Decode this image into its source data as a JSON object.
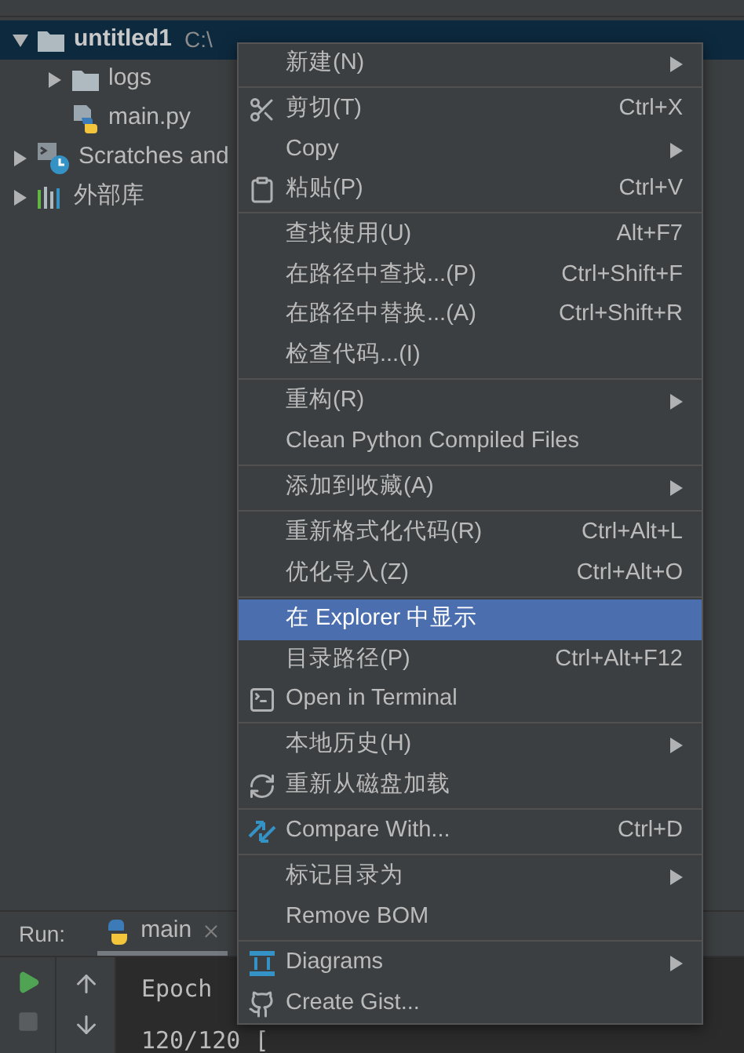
{
  "tree": [
    {
      "label": "untitled1",
      "path": "C:\\",
      "kind": "folder",
      "expanded": true,
      "selected": true,
      "children": [
        {
          "label": "logs",
          "kind": "folder",
          "expanded": false,
          "selected": false
        },
        {
          "label": "main.py",
          "kind": "python-file",
          "selected": false
        }
      ]
    },
    {
      "label": "Scratches and",
      "kind": "scratches",
      "expanded": false,
      "selected": false
    },
    {
      "label": "外部库",
      "kind": "library",
      "expanded": false,
      "selected": false
    }
  ],
  "context_menu": {
    "groups": [
      [
        {
          "label": "新建(N)",
          "submenu": true,
          "selected": false
        }
      ],
      [
        {
          "label": "剪切(T)",
          "shortcut": "Ctrl+X",
          "kind": "cut",
          "submenu": false,
          "selected": false
        },
        {
          "label": "Copy",
          "submenu": true,
          "selected": false
        },
        {
          "label": "粘贴(P)",
          "shortcut": "Ctrl+V",
          "kind": "paste",
          "submenu": false,
          "selected": false
        }
      ],
      [
        {
          "label": "查找使用(U)",
          "shortcut": "Alt+F7",
          "submenu": false,
          "selected": false
        },
        {
          "label": "在路径中查找...(P)",
          "shortcut": "Ctrl+Shift+F",
          "submenu": false,
          "selected": false
        },
        {
          "label": "在路径中替换...(A)",
          "shortcut": "Ctrl+Shift+R",
          "submenu": false,
          "selected": false
        },
        {
          "label": "检查代码...(I)",
          "submenu": false,
          "selected": false
        }
      ],
      [
        {
          "label": "重构(R)",
          "submenu": true,
          "selected": false
        },
        {
          "label": "Clean Python Compiled Files",
          "submenu": false,
          "selected": false
        }
      ],
      [
        {
          "label": "添加到收藏(A)",
          "submenu": true,
          "selected": false
        }
      ],
      [
        {
          "label": "重新格式化代码(R)",
          "shortcut": "Ctrl+Alt+L",
          "submenu": false,
          "selected": false
        },
        {
          "label": "优化导入(Z)",
          "shortcut": "Ctrl+Alt+O",
          "submenu": false,
          "selected": false
        }
      ],
      [
        {
          "label": "在 Explorer 中显示",
          "submenu": false,
          "selected": true
        },
        {
          "label": "目录路径(P)",
          "shortcut": "Ctrl+Alt+F12",
          "submenu": false,
          "selected": false
        },
        {
          "label": "Open in Terminal",
          "kind": "terminal",
          "submenu": false,
          "selected": false
        }
      ],
      [
        {
          "label": "本地历史(H)",
          "submenu": true,
          "selected": false
        },
        {
          "label": "重新从磁盘加载",
          "kind": "reload",
          "submenu": false,
          "selected": false
        }
      ],
      [
        {
          "label": "Compare With...",
          "shortcut": "Ctrl+D",
          "kind": "compare",
          "submenu": false,
          "selected": false
        }
      ],
      [
        {
          "label": "标记目录为",
          "submenu": true,
          "selected": false
        },
        {
          "label": "Remove BOM",
          "submenu": false,
          "selected": false
        }
      ],
      [
        {
          "label": "Diagrams",
          "kind": "diagram",
          "submenu": true,
          "selected": false
        },
        {
          "label": "Create Gist...",
          "kind": "github",
          "submenu": false,
          "selected": false
        }
      ]
    ]
  },
  "run_panel": {
    "label": "Run:",
    "tabs": [
      {
        "label": "main",
        "selected": true
      }
    ],
    "console_lines": [
      "Epoch",
      "120/120 ["
    ]
  }
}
